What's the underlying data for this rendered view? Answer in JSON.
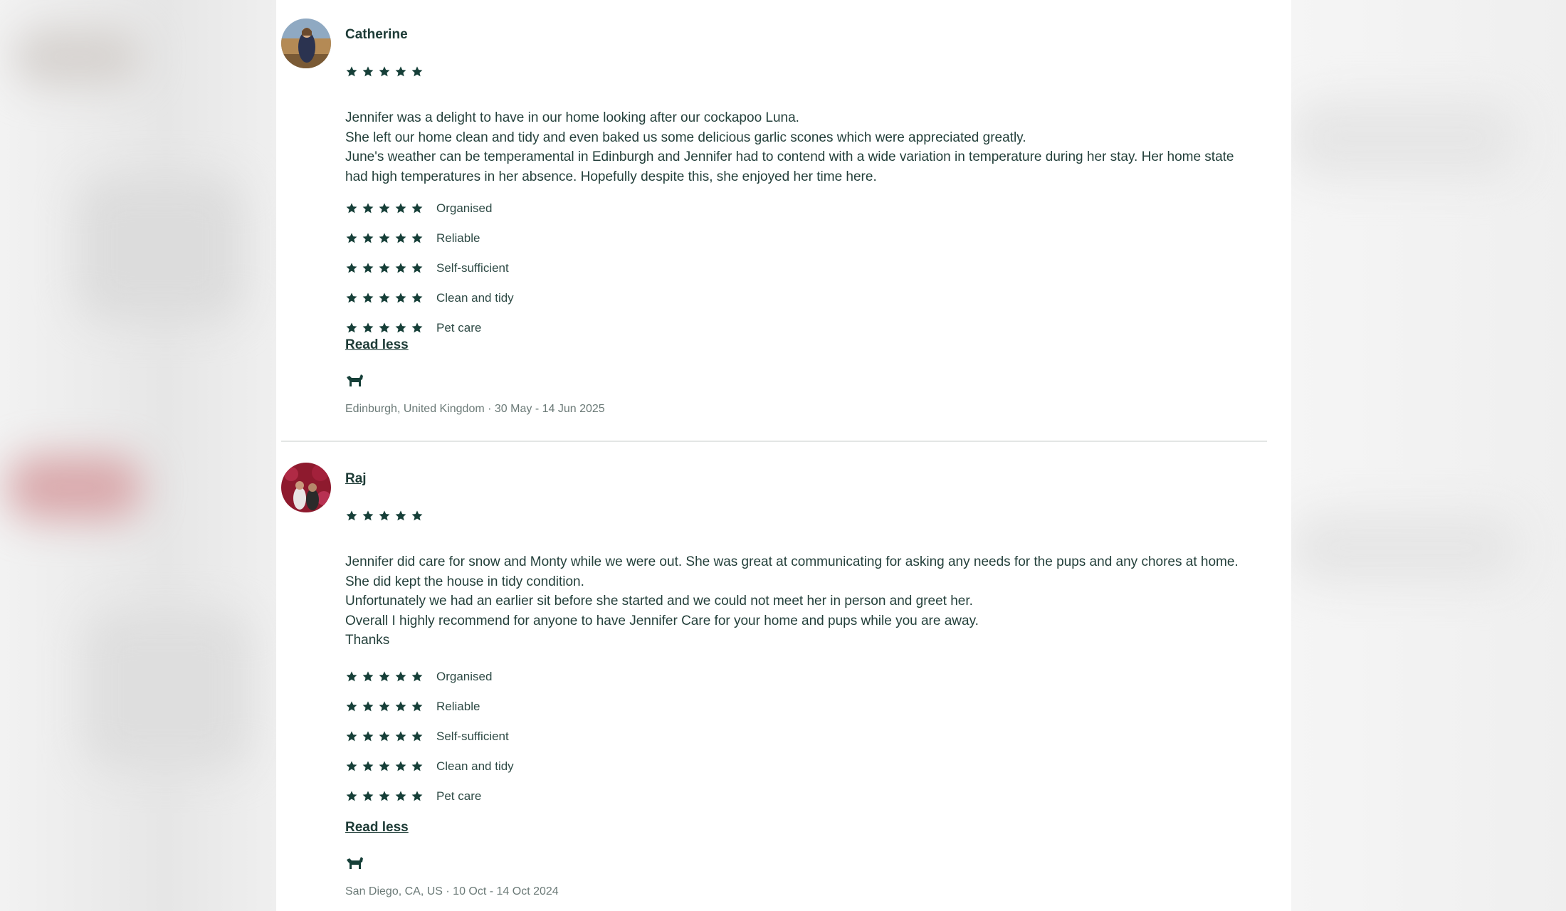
{
  "colors": {
    "star": "#163f38",
    "text": "#24403b",
    "heading": "#1d3b36",
    "meta": "#6b7a77",
    "divider": "#e3e6e5"
  },
  "reviews": [
    {
      "reviewer": "Catherine",
      "overall_rating": 5,
      "text": [
        "Jennifer was a delight to have in our home looking after our cockapoo Luna.",
        "She left our home clean and tidy and even baked us some delicious garlic scones which were appreciated greatly.",
        "June's weather can be temperamental in Edinburgh and Jennifer had to contend with a wide variation in temperature during her stay. Her home state had high temperatures in her absence. Hopefully despite this, she enjoyed her time here."
      ],
      "criteria": [
        {
          "label": "Organised",
          "rating": 5
        },
        {
          "label": "Reliable",
          "rating": 5
        },
        {
          "label": "Self-sufficient",
          "rating": 5
        },
        {
          "label": "Clean and tidy",
          "rating": 5
        },
        {
          "label": "Pet care",
          "rating": 5
        }
      ],
      "read_less_label": "Read less",
      "pet_icon": "dog-icon",
      "meta": "Edinburgh, United Kingdom · 30 May - 14 Jun 2025"
    },
    {
      "reviewer": "Raj",
      "overall_rating": 5,
      "text": [
        "Jennifer did care for snow and Monty while we were out. She was great at communicating for asking any needs for the pups and any chores at home.",
        "She did kept the house in tidy condition.",
        "Unfortunately we had an earlier sit before she started and we could not meet her in person and greet her.",
        "Overall I highly recommend for anyone to have Jennifer Care for your home and pups while you are away.",
        "Thanks"
      ],
      "criteria": [
        {
          "label": "Organised",
          "rating": 5
        },
        {
          "label": "Reliable",
          "rating": 5
        },
        {
          "label": "Self-sufficient",
          "rating": 5
        },
        {
          "label": "Clean and tidy",
          "rating": 5
        },
        {
          "label": "Pet care",
          "rating": 5
        }
      ],
      "read_less_label": "Read less",
      "pet_icon": "dog-icon",
      "meta": "San Diego, CA, US · 10 Oct - 14 Oct 2024"
    }
  ]
}
